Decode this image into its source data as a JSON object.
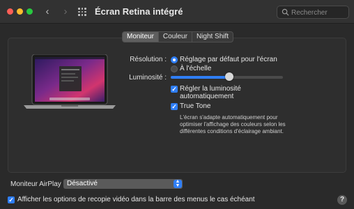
{
  "window": {
    "title": "Écran Retina intégré",
    "search_placeholder": "Rechercher"
  },
  "tabs": [
    {
      "label": "Moniteur",
      "active": true
    },
    {
      "label": "Couleur",
      "active": false
    },
    {
      "label": "Night Shift",
      "active": false
    }
  ],
  "display": {
    "resolution_label": "Résolution :",
    "resolution_options": [
      {
        "label": "Réglage par défaut pour l'écran",
        "selected": true
      },
      {
        "label": "À l'échelle",
        "selected": false
      }
    ],
    "brightness_label": "Luminosité :",
    "brightness_level": 0.52,
    "auto_brightness": {
      "line1": "Régler la luminosité",
      "line2": "automatiquement",
      "checked": true
    },
    "true_tone": {
      "label": "True Tone",
      "checked": true,
      "description": "L'écran s'adapte automatiquement pour optimiser l'affichage des couleurs selon les différentes conditions d'éclairage ambiant."
    }
  },
  "airplay": {
    "label": "Moniteur AirPlay :",
    "value": "Désactivé"
  },
  "mirroring_option": {
    "label": "Afficher les options de recopie vidéo dans la barre des menus le cas échéant",
    "checked": true
  },
  "help_label": "?",
  "colors": {
    "accent": "#2f7ef6",
    "background": "#2a2a2a"
  }
}
